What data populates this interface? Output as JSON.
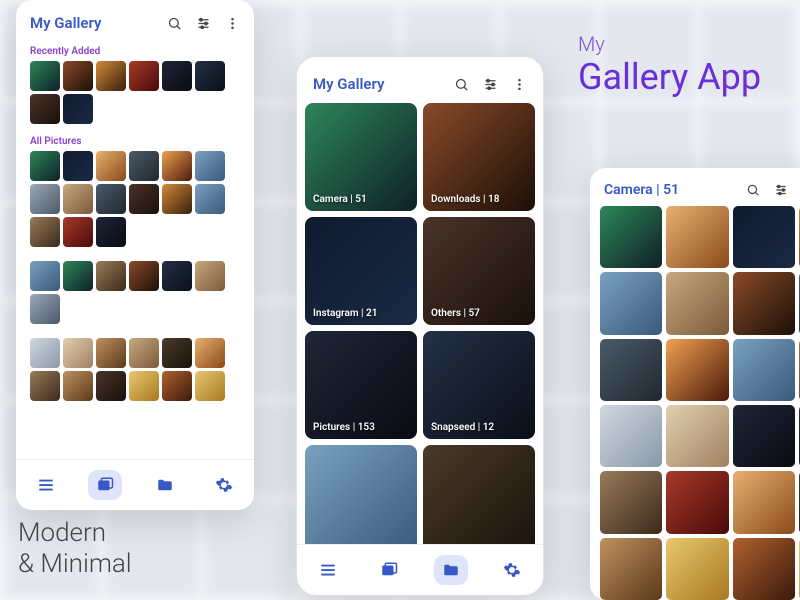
{
  "hero": {
    "top": "My",
    "bottom": "Gallery App"
  },
  "tagline_line1": "Modern",
  "tagline_line2": "& Minimal",
  "screen1": {
    "title": "My Gallery",
    "section_recent": "Recently Added",
    "section_all": "All Pictures"
  },
  "screen2": {
    "title": "My Gallery",
    "albums": [
      {
        "name": "Camera",
        "count": 51
      },
      {
        "name": "Downloads",
        "count": 18
      },
      {
        "name": "Instagram",
        "count": 21
      },
      {
        "name": "Others",
        "count": 57
      },
      {
        "name": "Pictures",
        "count": 153
      },
      {
        "name": "Snapseed",
        "count": 12
      }
    ]
  },
  "screen3": {
    "title": "Camera | 51"
  }
}
